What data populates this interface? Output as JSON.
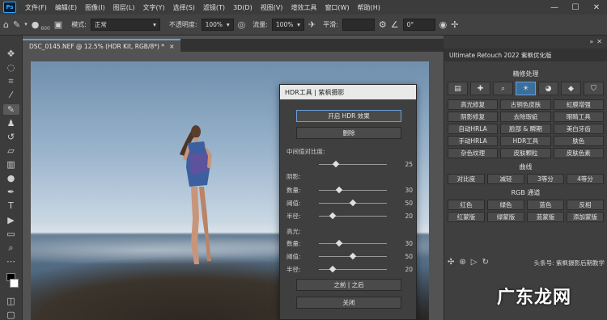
{
  "menu": {
    "logo": "Ps",
    "items": [
      "文件(F)",
      "编辑(E)",
      "图像(I)",
      "图层(L)",
      "文字(Y)",
      "选择(S)",
      "滤镜(T)",
      "3D(D)",
      "视图(V)",
      "增效工具",
      "窗口(W)",
      "帮助(H)"
    ],
    "window_buttons": [
      "—",
      "☐",
      "✕"
    ]
  },
  "options": {
    "brush_size": "600",
    "mode_label": "模式:",
    "mode_value": "正常",
    "opacity_label": "不透明度:",
    "opacity_value": "100%",
    "flow_label": "流量:",
    "flow_value": "100%",
    "smooth_label": "平滑:",
    "angle_value": "0°"
  },
  "document": {
    "tab_title": "DSC_0145.NEF @ 12.5% (HDR Kit, RGB/8*) *",
    "close": "×"
  },
  "hdr_dialog": {
    "title": "HDR工具 | 紫枫摄影",
    "enable_button": "开启 HDR 效果",
    "delete_button": "删除",
    "midtone_label": "中间值对比度:",
    "midtone": {
      "value": "25",
      "level": 0.25
    },
    "shadow_label": "阴影:",
    "shadows": [
      {
        "name": "数量:",
        "value": "30",
        "level": 0.3
      },
      {
        "name": "阈值:",
        "value": "50",
        "level": 0.5
      },
      {
        "name": "半径:",
        "value": "20",
        "level": 0.2
      }
    ],
    "highlight_label": "高光:",
    "highlights": [
      {
        "name": "数量:",
        "value": "30",
        "level": 0.3
      },
      {
        "name": "阈值:",
        "value": "50",
        "level": 0.5
      },
      {
        "name": "半径:",
        "value": "20",
        "level": 0.2
      }
    ],
    "before_after_button": "之前 | 之后",
    "close_button": "关闭"
  },
  "right_panel": {
    "header": "Ultimate Retouch 2022 紫枫优化版",
    "section_fine": "精修处理",
    "fine_buttons": [
      "高光修复",
      "古铜色皮肤",
      "虹膜增强",
      "阴影修复",
      "去除瑕疵",
      "眼睛工具",
      "自动HRLA",
      "脸部 & 瞬期",
      "美白牙齿",
      "手动HRLA",
      "HDR工具",
      "肤色",
      "杂色纹理",
      "皮肤颗粒",
      "皮肤色素"
    ],
    "section_curve": "曲线",
    "curve_buttons": [
      "对比度",
      "减轻",
      "3等分",
      "4等分"
    ],
    "section_rgb": "RGB 通道",
    "rgb_buttons": [
      "红色",
      "绿色",
      "蓝色",
      "反相",
      "红蒙版",
      "绿蒙版",
      "蓝蒙版",
      "添加蒙版"
    ],
    "credit": "头条号: 紫枫摄影后期教学"
  },
  "watermark": "广东龙网"
}
